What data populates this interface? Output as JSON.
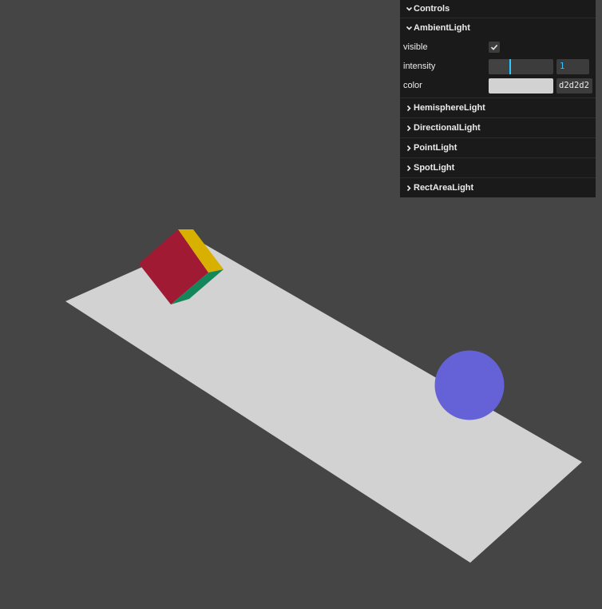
{
  "panel": {
    "title": "Controls",
    "folders": [
      {
        "label": "AmbientLight",
        "expanded": true,
        "controls": {
          "visible_label": "visible",
          "visible_checked": true,
          "intensity_label": "intensity",
          "intensity_value": "1",
          "intensity_fraction": 0.33,
          "color_label": "color",
          "color_hex": "d2d2d2",
          "color_swatch": "#d2d2d2"
        }
      },
      {
        "label": "HemisphereLight",
        "expanded": false
      },
      {
        "label": "DirectionalLight",
        "expanded": false
      },
      {
        "label": "PointLight",
        "expanded": false
      },
      {
        "label": "SpotLight",
        "expanded": false
      },
      {
        "label": "RectAreaLight",
        "expanded": false
      }
    ]
  },
  "scene": {
    "background": "#454545",
    "plane_color": "#d2d2d2",
    "cube_colors": [
      "#a11a33",
      "#d8b100",
      "#14875a"
    ],
    "sphere_color": "#6462d6"
  },
  "icons": {
    "expanded": "chevron-down-icon",
    "collapsed": "chevron-right-icon",
    "check": "check-icon"
  }
}
